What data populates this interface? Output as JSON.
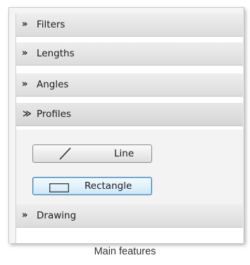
{
  "panel": {
    "sections": [
      {
        "label": "Filters",
        "state": "collapsed",
        "chevron": "»"
      },
      {
        "label": "Lengths",
        "state": "collapsed",
        "chevron": "»"
      },
      {
        "label": "Angles",
        "state": "collapsed",
        "chevron": "»"
      },
      {
        "label": "Profiles",
        "state": "expanded",
        "chevron": "≫"
      },
      {
        "label": "Drawing",
        "state": "collapsed",
        "chevron": "»"
      }
    ],
    "profiles": {
      "line_button": {
        "label": "Line",
        "icon": "diagonal-line-icon"
      },
      "rectangle_button": {
        "label": "Rectangle",
        "icon": "rectangle-icon",
        "selected": true
      }
    }
  },
  "caption": "Main features",
  "colors": {
    "header_bg": "#e4e4e4",
    "selected_border": "#3c7fb1",
    "selected_fill": "#e2f1fb"
  }
}
